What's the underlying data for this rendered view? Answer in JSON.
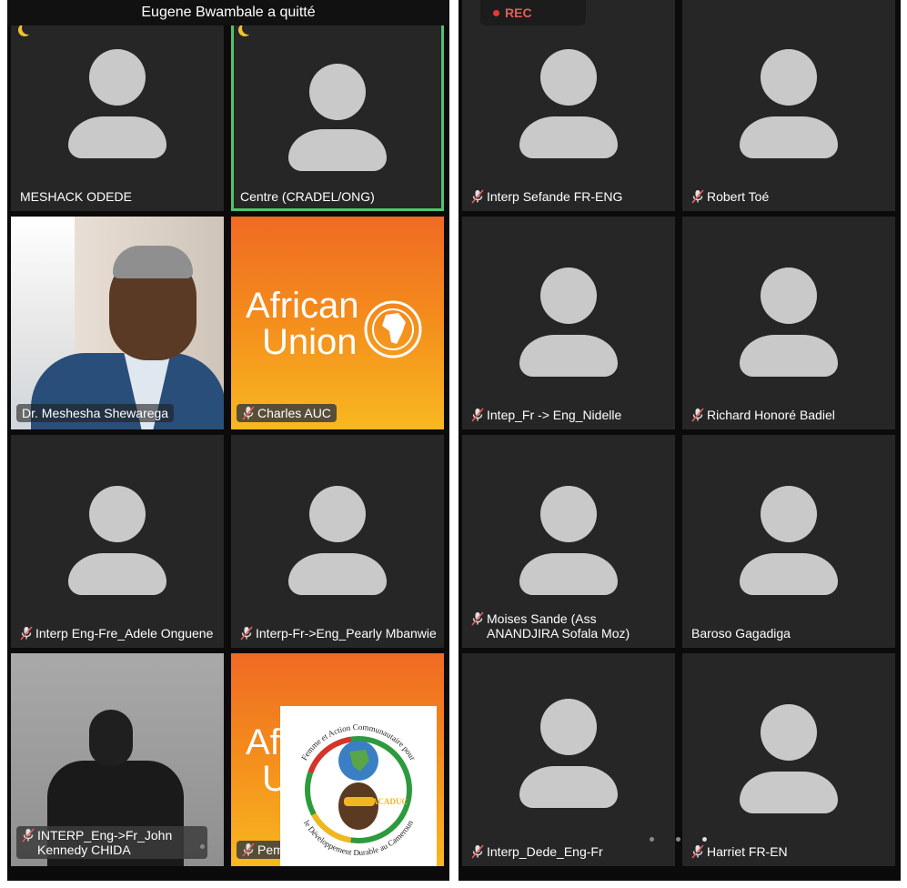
{
  "left_panel": {
    "banner": "Eugene Bwambale a quitté",
    "tiles": [
      {
        "name": "MESHACK ODEDE"
      },
      {
        "name": "Centre (CRADEL/ONG)"
      },
      {
        "name": "Dr. Meshesha Shewarega"
      },
      {
        "name": "Charles AUC",
        "overlay": {
          "line1": "African",
          "line2": "Union"
        }
      },
      {
        "name": "Interp Eng-Fre_Adele Onguene"
      },
      {
        "name": "Interp-Fr->Eng_Pearly Mbanwie"
      },
      {
        "name": "INTERP_Eng->Fr_John Kennedy CHIDA"
      },
      {
        "name": "Pem",
        "overlay": {
          "line1": "Afr",
          "line2": "U"
        }
      }
    ],
    "logo": {
      "arc_top": "Femme et Action Communautaire pour",
      "arc_bottom": "le Développement Durable au Cameroun",
      "acronym": "FACADUC"
    }
  },
  "right_panel": {
    "rec_label": "REC",
    "tiles": [
      {
        "name": "Interp Sefande FR-ENG"
      },
      {
        "name": "Robert Toé"
      },
      {
        "name": "Intep_Fr -> Eng_Nidelle"
      },
      {
        "name": "Richard Honoré Badiel"
      },
      {
        "name": "Moises Sande (Ass ANANDJIRA Sofala Moz)"
      },
      {
        "name": "Baroso Gagadiga"
      },
      {
        "name": "Interp_Dede_Eng-Fr"
      },
      {
        "name": "Harriet FR-EN"
      }
    ]
  },
  "colors": {
    "active_speaker": "#4fc46d",
    "rec": "#e85a5a",
    "tile_bg": "#262626",
    "avatar": "#c9c9c9"
  }
}
